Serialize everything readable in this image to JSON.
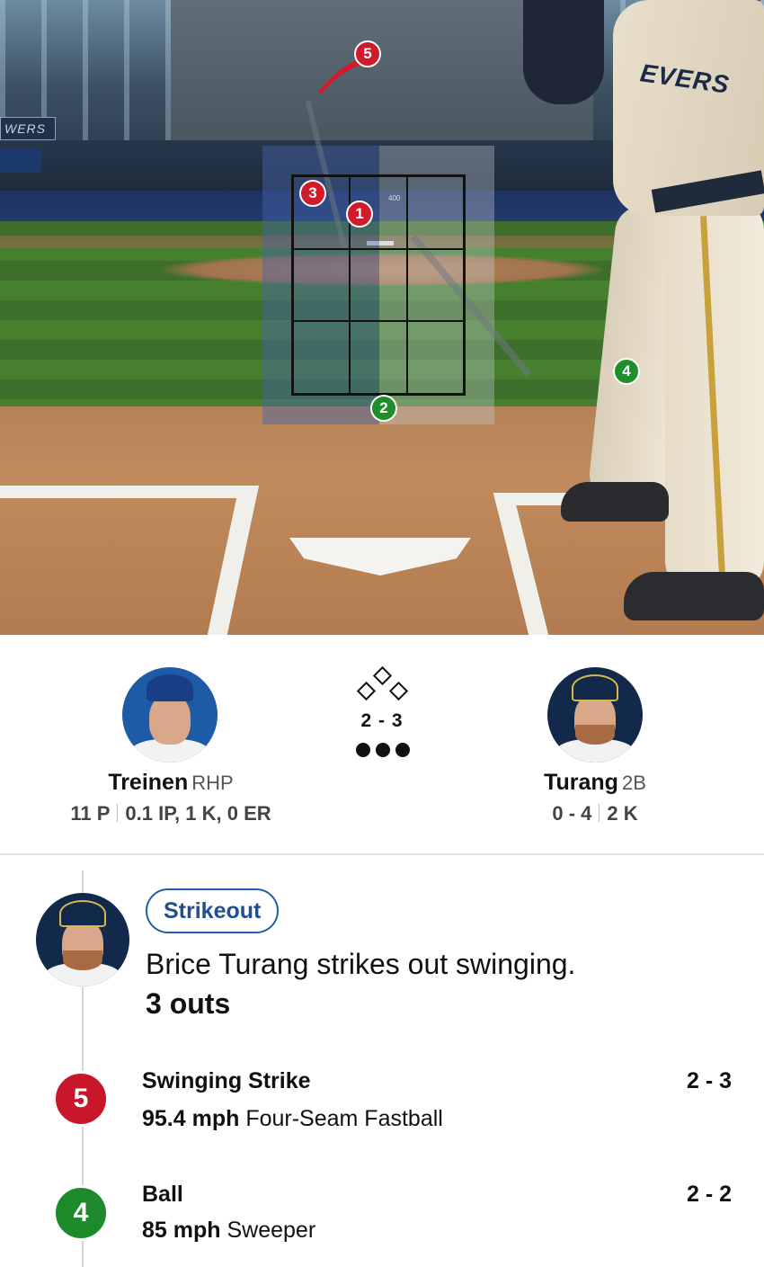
{
  "field": {
    "scoreboard_text": "WERS",
    "jersey_text": "EVERS",
    "zone_marker_400": "400",
    "pitch_markers": [
      "5",
      "3",
      "1",
      "4",
      "2"
    ]
  },
  "matchup": {
    "pitcher": {
      "name": "Treinen",
      "role": "RHP",
      "pitches": "11 P",
      "line": "0.1 IP, 1 K, 0 ER"
    },
    "batter": {
      "name": "Turang",
      "role": "2B",
      "line": "0 - 4",
      "strikeouts": "2 K"
    },
    "count": "2 - 3",
    "outs": 3
  },
  "play": {
    "badge": "Strikeout",
    "description": "Brice Turang strikes out swinging.",
    "outs": "3 outs"
  },
  "pitches": [
    {
      "num": "5",
      "result": "Swinging Strike",
      "speed": "95.4 mph",
      "type": "Four-Seam Fastball",
      "count": "2 - 3",
      "color": "#c9162b"
    },
    {
      "num": "4",
      "result": "Ball",
      "speed": "85 mph",
      "type": "Sweeper",
      "count": "2 - 2",
      "color": "#1d8a2c"
    }
  ],
  "colors": {
    "strike": "#c9162b",
    "ball": "#1d8a2c",
    "badge": "#1f5ea8",
    "dodgers_blue": "#1d5ba6",
    "brewers_navy": "#13294b"
  }
}
